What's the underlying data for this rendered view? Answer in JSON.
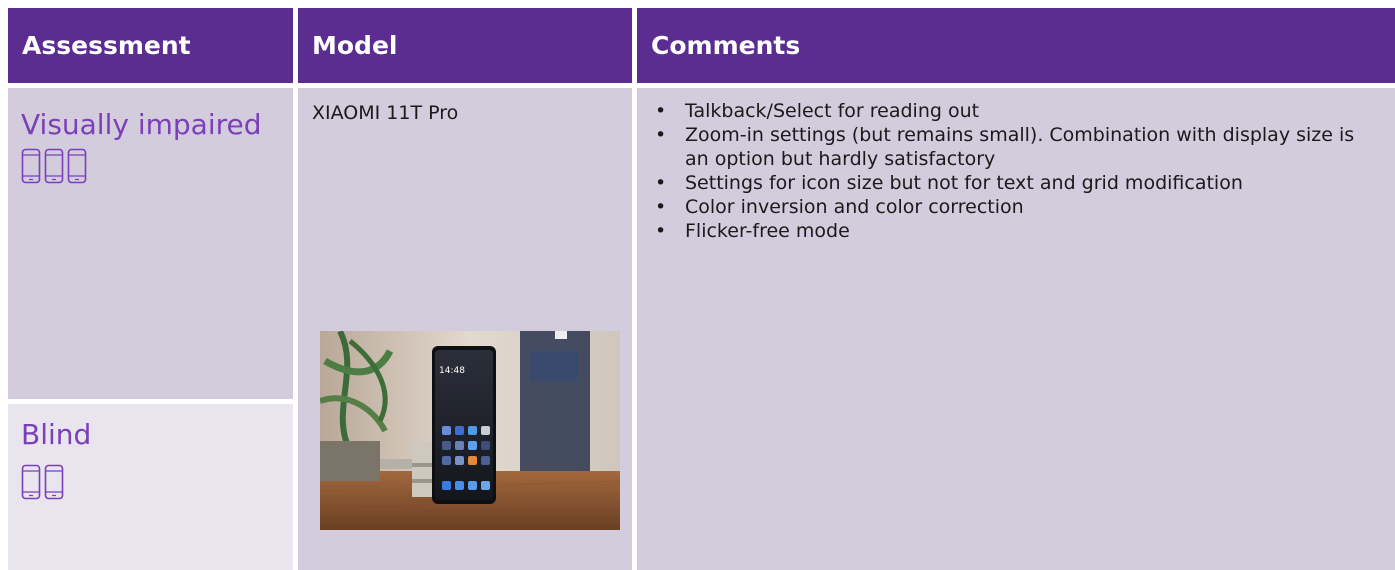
{
  "header": {
    "assessment": "Assessment",
    "model": "Model",
    "comments": "Comments"
  },
  "rows": {
    "visually_impaired": {
      "label": "Visually impaired",
      "phone_icon_count": 3
    },
    "blind": {
      "label": "Blind",
      "phone_icon_count": 2
    }
  },
  "model": {
    "name": "XIAOMI 11T Pro",
    "photo_clock": "14:48"
  },
  "comments": [
    "Talkback/Select for reading out",
    "Zoom-in settings (but remains small). Combination with display size is an option but hardly satisfactory",
    "Settings for icon size but not for text and grid modification",
    "Color inversion and color correction",
    "Flicker-free mode"
  ],
  "colors": {
    "header_bg": "#5b2d90",
    "header_text": "#ffffff",
    "body_lavender": "#d3ccdd",
    "body_light": "#e9e5ee",
    "accent_purple": "#7b3fb8"
  }
}
